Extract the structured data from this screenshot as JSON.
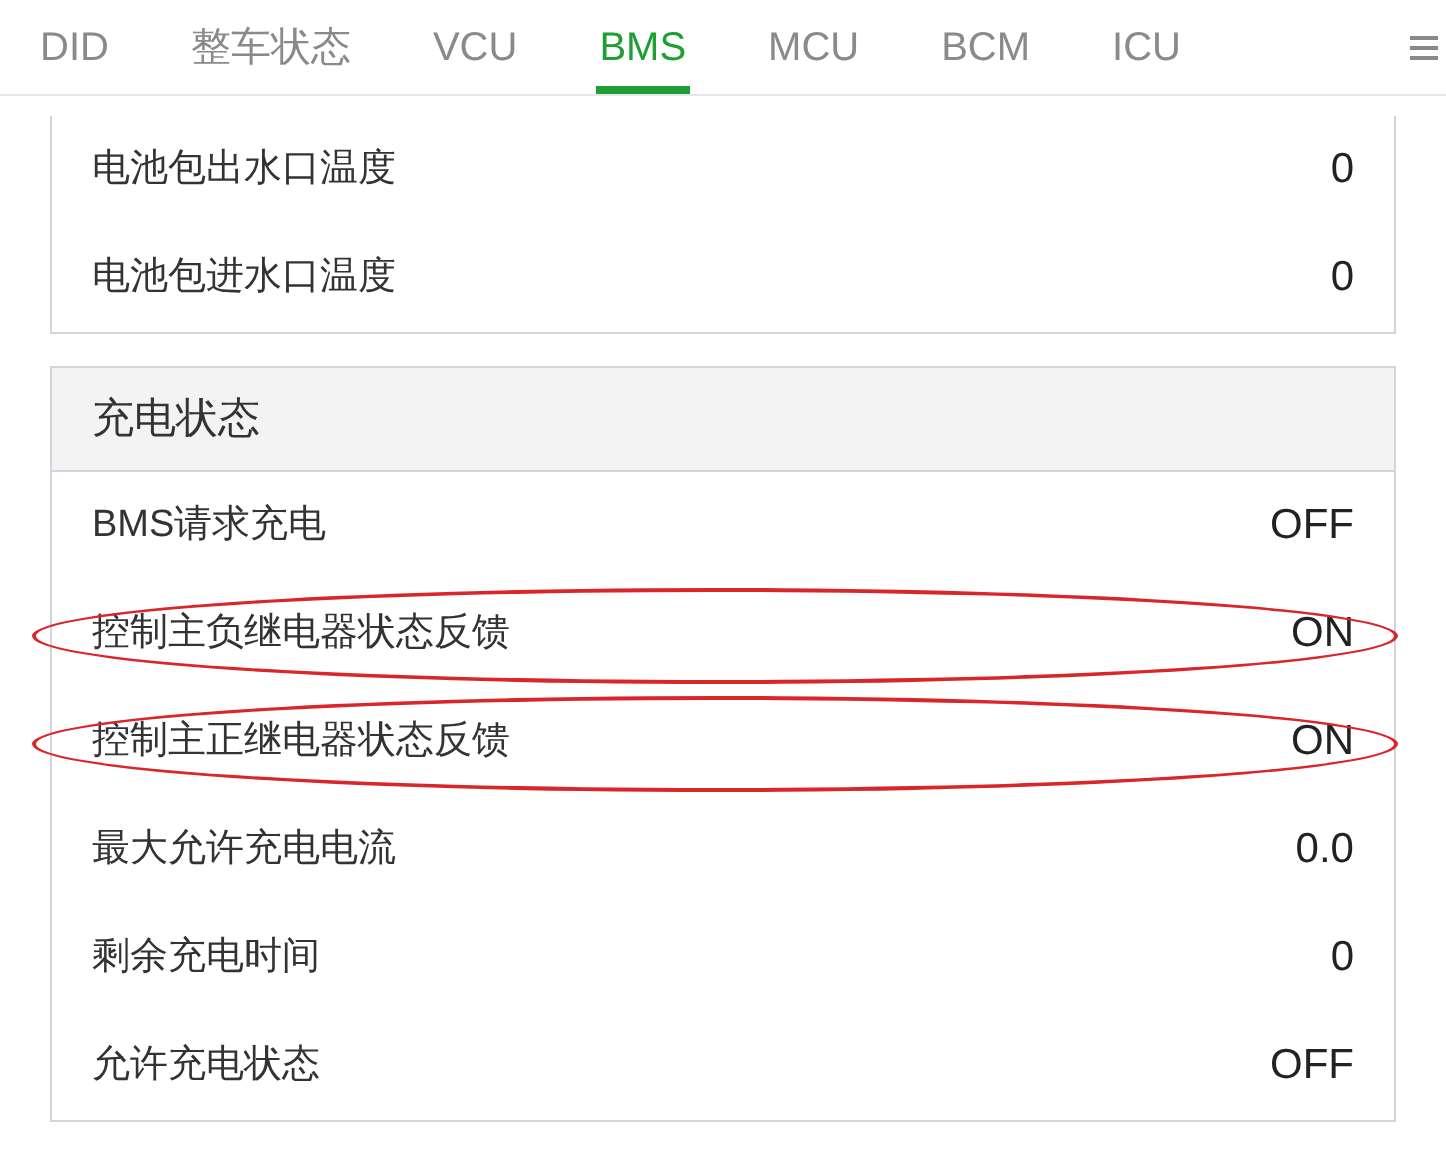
{
  "tabs": [
    {
      "label": "DID",
      "selected": false
    },
    {
      "label": "整车状态",
      "selected": false
    },
    {
      "label": "VCU",
      "selected": false
    },
    {
      "label": "BMS",
      "selected": true
    },
    {
      "label": "MCU",
      "selected": false
    },
    {
      "label": "BCM",
      "selected": false
    },
    {
      "label": "ICU",
      "selected": false
    }
  ],
  "sections": [
    {
      "rows": [
        {
          "label": "电池包出水口温度",
          "value": "0",
          "highlighted": false
        },
        {
          "label": "电池包进水口温度",
          "value": "0",
          "highlighted": false
        }
      ]
    },
    {
      "title": "充电状态",
      "rows": [
        {
          "label": "BMS请求充电",
          "value": "OFF",
          "highlighted": false
        },
        {
          "label": "控制主负继电器状态反馈",
          "value": "ON",
          "highlighted": true
        },
        {
          "label": "控制主正继电器状态反馈",
          "value": "ON",
          "highlighted": true
        },
        {
          "label": "最大允许充电电流",
          "value": "0.0",
          "highlighted": false
        },
        {
          "label": "剩余充电时间",
          "value": "0",
          "highlighted": false
        },
        {
          "label": "允许充电状态",
          "value": "OFF",
          "highlighted": false
        }
      ]
    }
  ]
}
